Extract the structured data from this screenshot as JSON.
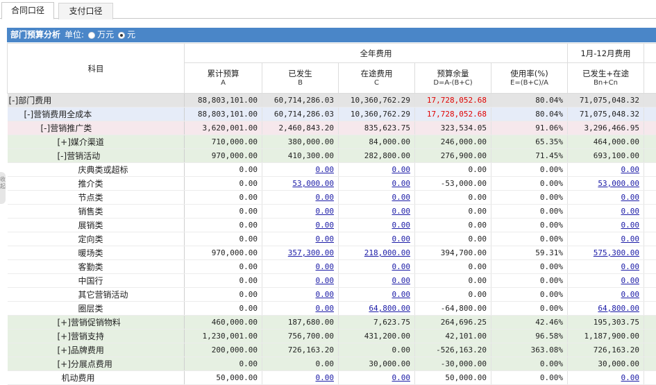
{
  "tabs": [
    {
      "label": "合同口径"
    },
    {
      "label": "支付口径"
    }
  ],
  "panel": {
    "title": "部门预算分析",
    "unit_label": "单位:",
    "unit_options": [
      "万元",
      "元"
    ],
    "unit_selected": "元"
  },
  "side_handle": {
    "label": "收起"
  },
  "table": {
    "header_subject": "科目",
    "header_full_year": "全年费用",
    "header_period": "1月-12月费用",
    "columns": [
      {
        "label": "累计预算",
        "sub": "A"
      },
      {
        "label": "已发生",
        "sub": "B"
      },
      {
        "label": "在途费用",
        "sub": "C"
      },
      {
        "label": "预算余量",
        "sub": "D=A-(B+C)"
      },
      {
        "label": "使用率(%)",
        "sub": "E=(B+C)/A"
      },
      {
        "label": "已发生+在途",
        "sub": "Bn+Cn"
      }
    ],
    "rows": [
      {
        "name": "[-]部门费用",
        "level": "l1",
        "bg": "bg-gray",
        "a": "88,803,101.00",
        "b": "60,714,286.03",
        "c": "10,360,762.29",
        "d": "17,728,052.68",
        "e": "80.04%",
        "f": "71,075,048.32",
        "d_red": true,
        "b_link": false,
        "c_link": false,
        "f_link": false
      },
      {
        "name": "[-]营销费用全成本",
        "level": "l2",
        "bg": "bg-blue",
        "a": "88,803,101.00",
        "b": "60,714,286.03",
        "c": "10,360,762.29",
        "d": "17,728,052.68",
        "e": "80.04%",
        "f": "71,075,048.32",
        "d_red": true,
        "b_link": false,
        "c_link": false,
        "f_link": false
      },
      {
        "name": "[-]营销推广类",
        "level": "l3",
        "bg": "bg-pink",
        "a": "3,620,001.00",
        "b": "2,460,843.20",
        "c": "835,623.75",
        "d": "323,534.05",
        "e": "91.06%",
        "f": "3,296,466.95",
        "d_red": false,
        "b_link": false,
        "c_link": false,
        "f_link": false
      },
      {
        "name": "[+]媒介渠道",
        "level": "l4",
        "bg": "bg-green",
        "a": "710,000.00",
        "b": "380,000.00",
        "c": "84,000.00",
        "d": "246,000.00",
        "e": "65.35%",
        "f": "464,000.00",
        "d_red": false,
        "b_link": false,
        "c_link": false,
        "f_link": false
      },
      {
        "name": "[-]营销活动",
        "level": "l4",
        "bg": "bg-green",
        "a": "970,000.00",
        "b": "410,300.00",
        "c": "282,800.00",
        "d": "276,900.00",
        "e": "71.45%",
        "f": "693,100.00",
        "d_red": false,
        "b_link": false,
        "c_link": false,
        "f_link": false
      },
      {
        "name": "庆典类或超标",
        "level": "l5",
        "bg": "bg-white",
        "a": "0.00",
        "b": "0.00",
        "c": "0.00",
        "d": "0.00",
        "e": "0.00%",
        "f": "0.00",
        "d_red": false,
        "b_link": true,
        "c_link": true,
        "f_link": true
      },
      {
        "name": "推介类",
        "level": "l5",
        "bg": "bg-white",
        "a": "0.00",
        "b": "53,000.00",
        "c": "0.00",
        "d": "-53,000.00",
        "e": "0.00%",
        "f": "53,000.00",
        "d_red": false,
        "b_link": true,
        "c_link": true,
        "f_link": true
      },
      {
        "name": "节点类",
        "level": "l5",
        "bg": "bg-white",
        "a": "0.00",
        "b": "0.00",
        "c": "0.00",
        "d": "0.00",
        "e": "0.00%",
        "f": "0.00",
        "d_red": false,
        "b_link": true,
        "c_link": true,
        "f_link": true
      },
      {
        "name": "销售类",
        "level": "l5",
        "bg": "bg-white",
        "a": "0.00",
        "b": "0.00",
        "c": "0.00",
        "d": "0.00",
        "e": "0.00%",
        "f": "0.00",
        "d_red": false,
        "b_link": true,
        "c_link": true,
        "f_link": true
      },
      {
        "name": "展销类",
        "level": "l5",
        "bg": "bg-white",
        "a": "0.00",
        "b": "0.00",
        "c": "0.00",
        "d": "0.00",
        "e": "0.00%",
        "f": "0.00",
        "d_red": false,
        "b_link": true,
        "c_link": true,
        "f_link": true
      },
      {
        "name": "定向类",
        "level": "l5",
        "bg": "bg-white",
        "a": "0.00",
        "b": "0.00",
        "c": "0.00",
        "d": "0.00",
        "e": "0.00%",
        "f": "0.00",
        "d_red": false,
        "b_link": true,
        "c_link": true,
        "f_link": true
      },
      {
        "name": "暖场类",
        "level": "l5",
        "bg": "bg-white",
        "a": "970,000.00",
        "b": "357,300.00",
        "c": "218,000.00",
        "d": "394,700.00",
        "e": "59.31%",
        "f": "575,300.00",
        "d_red": false,
        "b_link": true,
        "c_link": true,
        "f_link": true
      },
      {
        "name": "客勤类",
        "level": "l5",
        "bg": "bg-white",
        "a": "0.00",
        "b": "0.00",
        "c": "0.00",
        "d": "0.00",
        "e": "0.00%",
        "f": "0.00",
        "d_red": false,
        "b_link": true,
        "c_link": true,
        "f_link": true
      },
      {
        "name": "中国行",
        "level": "l5",
        "bg": "bg-white",
        "a": "0.00",
        "b": "0.00",
        "c": "0.00",
        "d": "0.00",
        "e": "0.00%",
        "f": "0.00",
        "d_red": false,
        "b_link": true,
        "c_link": true,
        "f_link": true
      },
      {
        "name": "其它营销活动",
        "level": "l5",
        "bg": "bg-white",
        "a": "0.00",
        "b": "0.00",
        "c": "0.00",
        "d": "0.00",
        "e": "0.00%",
        "f": "0.00",
        "d_red": false,
        "b_link": true,
        "c_link": true,
        "f_link": true
      },
      {
        "name": "圈层类",
        "level": "l5",
        "bg": "bg-white",
        "a": "0.00",
        "b": "0.00",
        "c": "64,800.00",
        "d": "-64,800.00",
        "e": "0.00%",
        "f": "64,800.00",
        "d_red": false,
        "b_link": true,
        "c_link": true,
        "f_link": true
      },
      {
        "name": "[+]营销促销物料",
        "level": "l4",
        "bg": "bg-green",
        "a": "460,000.00",
        "b": "187,680.00",
        "c": "7,623.75",
        "d": "264,696.25",
        "e": "42.46%",
        "f": "195,303.75",
        "d_red": false,
        "b_link": false,
        "c_link": false,
        "f_link": false
      },
      {
        "name": "[+]营销支持",
        "level": "l4",
        "bg": "bg-green",
        "a": "1,230,001.00",
        "b": "756,700.00",
        "c": "431,200.00",
        "d": "42,101.00",
        "e": "96.58%",
        "f": "1,187,900.00",
        "d_red": false,
        "b_link": false,
        "c_link": false,
        "f_link": false
      },
      {
        "name": "[+]品牌费用",
        "level": "l4",
        "bg": "bg-green",
        "a": "200,000.00",
        "b": "726,163.20",
        "c": "0.00",
        "d": "-526,163.20",
        "e": "363.08%",
        "f": "726,163.20",
        "d_red": false,
        "b_link": false,
        "c_link": false,
        "f_link": false
      },
      {
        "name": "[+]分展点费用",
        "level": "l4",
        "bg": "bg-green",
        "a": "0.00",
        "b": "0.00",
        "c": "30,000.00",
        "d": "-30,000.00",
        "e": "0.00%",
        "f": "30,000.00",
        "d_red": false,
        "b_link": false,
        "c_link": false,
        "f_link": false
      },
      {
        "name": "机动费用",
        "level": "l4b",
        "bg": "bg-white",
        "a": "50,000.00",
        "b": "0.00",
        "c": "0.00",
        "d": "50,000.00",
        "e": "0.00%",
        "f": "0.00",
        "d_red": false,
        "b_link": true,
        "c_link": true,
        "f_link": true
      }
    ]
  }
}
